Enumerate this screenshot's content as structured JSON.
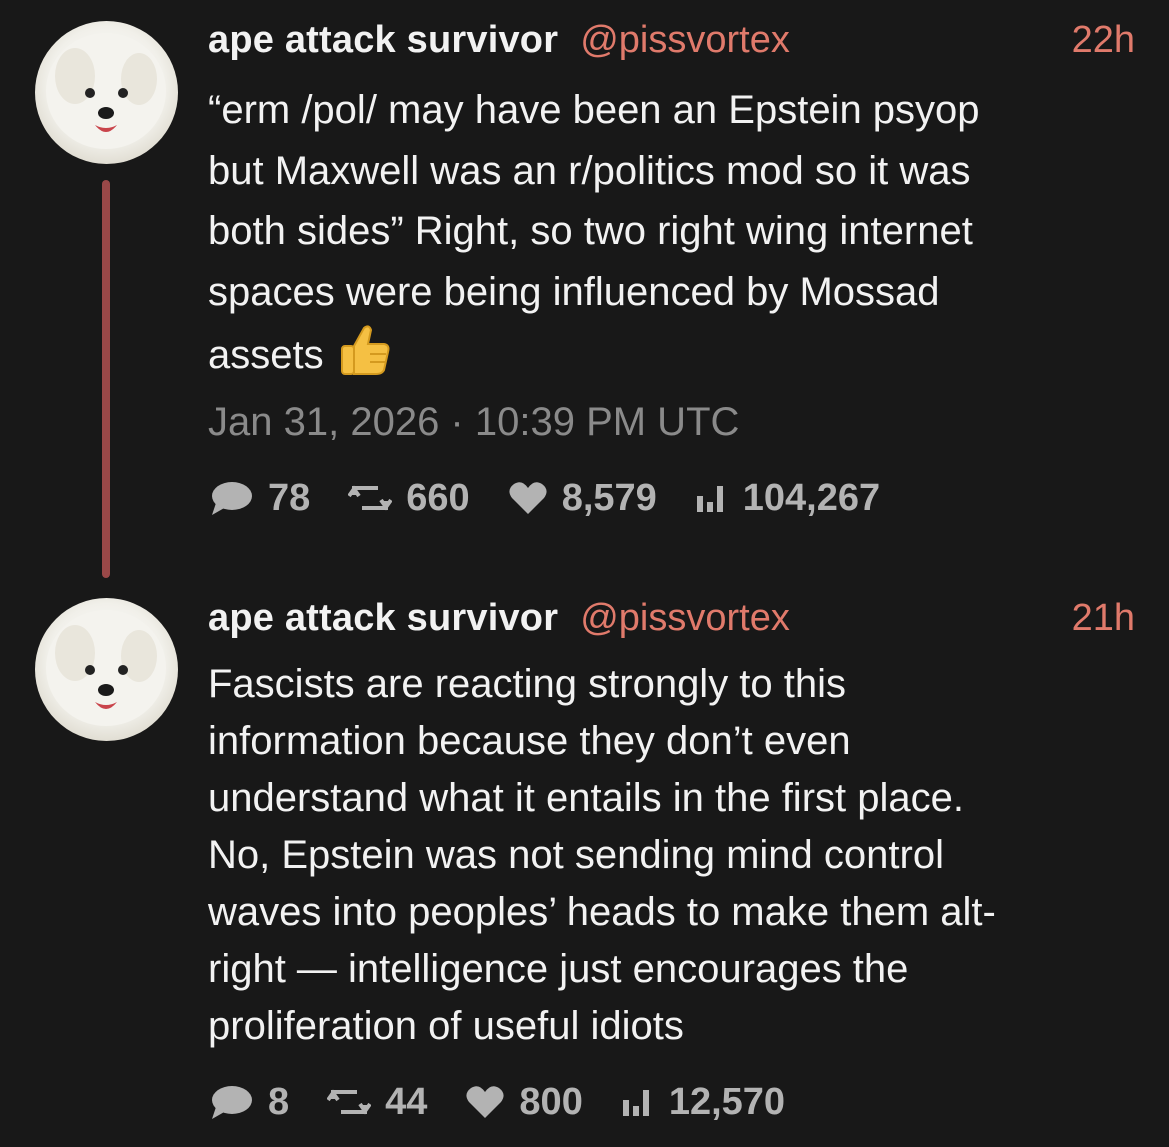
{
  "posts": [
    {
      "author_name": "ape attack survivor",
      "handle": "@pissvortex",
      "time_ago": "22h",
      "text": "“erm /pol/ may have been an Epstein psyop\nbut Maxwell was an r/politics mod so it was\nboth sides” Right, so two right wing internet\nspaces were being influenced by Mossad\nassets",
      "emoji": "thumbs-up-icon",
      "date": "Jan 31, 2026 · 10:39 PM UTC",
      "stats": {
        "replies": "78",
        "reposts": "660",
        "likes": "8,579",
        "views": "104,267"
      }
    },
    {
      "author_name": "ape attack survivor",
      "handle": "@pissvortex",
      "time_ago": "21h",
      "text": "Fascists are reacting strongly to this\ninformation because they don’t even\nunderstand what it entails in the first place.\nNo, Epstein was not sending mind control\nwaves into peoples’ heads to make them alt-\nright — intelligence just encourages the\nproliferation of useful idiots",
      "stats": {
        "replies": "8",
        "reposts": "44",
        "likes": "800",
        "views": "12,570"
      }
    }
  ],
  "colors": {
    "background": "#181818",
    "accent": "#e07a6b",
    "thread_line": "#9a4848",
    "muted": "#8a8a8a",
    "stats": "#b3b3b3"
  }
}
